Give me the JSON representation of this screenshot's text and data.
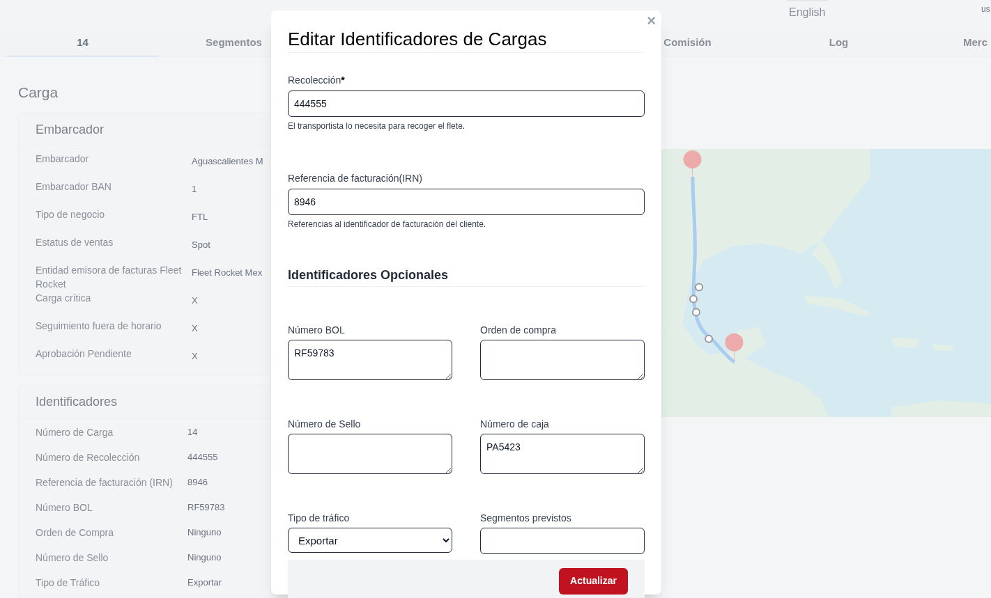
{
  "header": {
    "language": "English",
    "user": "us"
  },
  "tabs": [
    {
      "label": "14",
      "selected": true
    },
    {
      "label": "Segmentos",
      "selected": false
    },
    {
      "label": "Comisión",
      "selected": false
    },
    {
      "label": "Log",
      "selected": false
    },
    {
      "label": "Merc",
      "selected": false
    }
  ],
  "page_title": "Carga",
  "cards": [
    {
      "title": "Embarcador",
      "rows": [
        {
          "label": "Embarcador",
          "value": "Aguascalientes M"
        },
        {
          "label": "Embarcador BAN",
          "value": "1"
        },
        {
          "label": "Tipo de negocio",
          "value": "FTL"
        },
        {
          "label": "Estatus de ventas",
          "value": "Spot"
        },
        {
          "label": "Entidad emisora de facturas Fleet Rocket",
          "value": "Fleet Rocket Mex"
        },
        {
          "label": "Carga crítica",
          "value": "X"
        },
        {
          "label": "Seguimiento fuera de horario",
          "value": "X"
        },
        {
          "label": "Aprobación Pendiente",
          "value": "X"
        }
      ]
    },
    {
      "title": "Identificadores",
      "rows": [
        {
          "label": "Número de Carga",
          "value": "14"
        },
        {
          "label": "Número de Recolección",
          "value": "444555"
        },
        {
          "label": "Referencia de facturación (IRN)",
          "value": "8946"
        },
        {
          "label": "Número BOL",
          "value": "RF59783"
        },
        {
          "label": "Orden de Compra",
          "value": "Ninguno"
        },
        {
          "label": "Número de Sello",
          "value": "Ninguno"
        },
        {
          "label": "Tipo de Tráfico",
          "value": "Exportar"
        }
      ]
    }
  ],
  "modal": {
    "title": "Editar Identificadores de Cargas",
    "close": "×",
    "required_fields": [
      {
        "label": "Recolección",
        "required_mark": "*",
        "value": "444555",
        "help": "El transportista lo necesita para recoger el flete."
      },
      {
        "label": "Referencia de facturación(IRN)",
        "value": "8946",
        "help": "Referencias al identificador de facturación del cliente."
      }
    ],
    "section_title": "Identificadores Opcionales",
    "optional_fields": [
      {
        "label": "Número BOL",
        "kind": "textarea",
        "value": "RF59783"
      },
      {
        "label": "Orden de compra",
        "kind": "textarea"
      },
      {
        "label": "Número de Sello",
        "kind": "textarea"
      },
      {
        "label": "Número de caja",
        "kind": "textarea",
        "value": "PA5423"
      },
      {
        "label": "Tipo de tráfico",
        "kind": "select",
        "value": "Exportar"
      },
      {
        "label": "Segmentos previstos",
        "kind": "input"
      }
    ],
    "submit": "Actualizar"
  }
}
